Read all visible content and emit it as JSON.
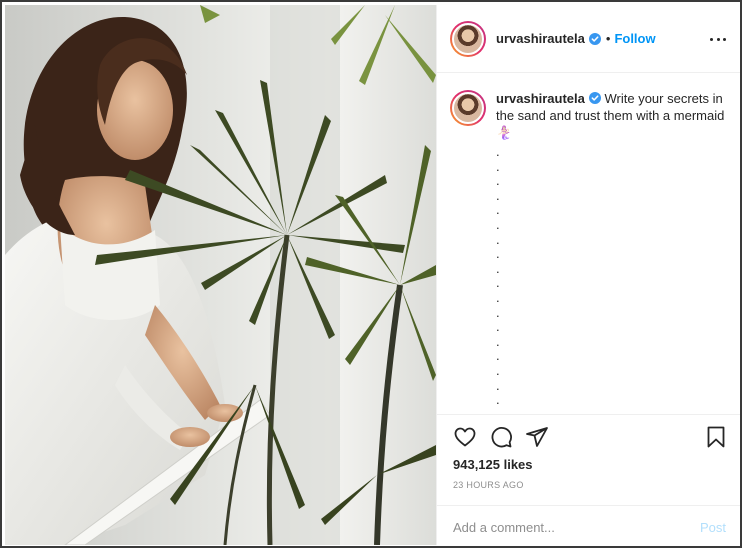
{
  "post": {
    "image_alt": "Woman in white robe leaning on a railing beside a palm plant",
    "header": {
      "username": "urvashirautela",
      "separator": "•",
      "follow_label": "Follow",
      "verified_icon": "verified-badge-icon",
      "more_icon": "more-options-icon"
    },
    "caption": {
      "username": "urvashirautela",
      "text": "Write your secrets in the sand and trust them with a mermaid 🧜🏻‍♀️",
      "dots": [
        ".",
        ".",
        ".",
        ".",
        ".",
        ".",
        ".",
        ".",
        ".",
        ".",
        ".",
        ".",
        ".",
        ".",
        ".",
        ".",
        ".",
        "."
      ]
    },
    "actions": {
      "like_icon": "heart-icon",
      "comment_icon": "comment-icon",
      "share_icon": "share-icon",
      "save_icon": "bookmark-icon"
    },
    "likes": "943,125 likes",
    "timestamp": "23 HOURS AGO",
    "comment": {
      "placeholder": "Add a comment...",
      "post_label": "Post"
    }
  },
  "colors": {
    "link_blue": "#0095f6",
    "post_disabled": "#b2dffc",
    "muted_text": "#8e8e8e",
    "divider": "#efefef"
  }
}
